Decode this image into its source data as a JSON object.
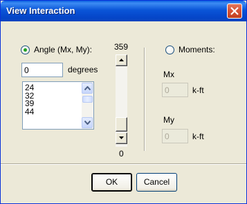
{
  "window": {
    "title": "View Interaction"
  },
  "angle": {
    "label": "Angle (Mx, My):",
    "value": "0",
    "unit": "degrees",
    "list_items": [
      "24",
      "32",
      "39",
      "44"
    ]
  },
  "slider": {
    "max_label": "359",
    "min_label": "0"
  },
  "moments": {
    "label": "Moments:",
    "mx_label": "Mx",
    "mx_value": "0",
    "mx_unit": "k-ft",
    "my_label": "My",
    "my_value": "0",
    "my_unit": "k-ft"
  },
  "buttons": {
    "ok": "OK",
    "cancel": "Cancel"
  },
  "colors": {
    "titlebar": "#0a55d8",
    "dialog_bg": "#ece9d8",
    "close_button": "#d8563b"
  }
}
